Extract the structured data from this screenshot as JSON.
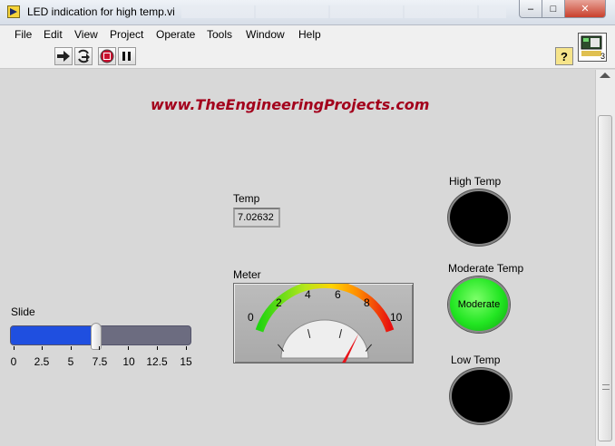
{
  "window": {
    "title": "LED indication for high temp.vi",
    "min_glyph": "–",
    "max_glyph": "□",
    "close_glyph": "✕"
  },
  "menu": [
    "File",
    "Edit",
    "View",
    "Project",
    "Operate",
    "Tools",
    "Window",
    "Help"
  ],
  "toolbar": {
    "help_glyph": "?",
    "icon_badge": "3"
  },
  "panel": {
    "site_url": "www.TheEngineeringProjects.com",
    "temp": {
      "label": "Temp",
      "value": "7.02632"
    },
    "meter": {
      "label": "Meter",
      "value": 7.02632,
      "min": 0,
      "max": 10,
      "scale": [
        "0",
        "2",
        "4",
        "6",
        "8",
        "10"
      ]
    },
    "slide": {
      "label": "Slide",
      "value": 7.02632,
      "min": 0,
      "max": 15,
      "scale": [
        "0",
        "2.5",
        "5",
        "7.5",
        "10",
        "12.5",
        "15"
      ]
    },
    "leds": {
      "high": {
        "label": "High Temp",
        "text": "",
        "on": false
      },
      "moderate": {
        "label": "Moderate Temp",
        "text": "Moderate",
        "on": true
      },
      "low": {
        "label": "Low Temp",
        "text": "",
        "on": false
      }
    }
  },
  "colors": {
    "led_off": "#000000",
    "led_on": "#22e622",
    "slider_fill": "#1f4fe0",
    "url_text": "#a3001c",
    "needle": "#e8141a"
  }
}
